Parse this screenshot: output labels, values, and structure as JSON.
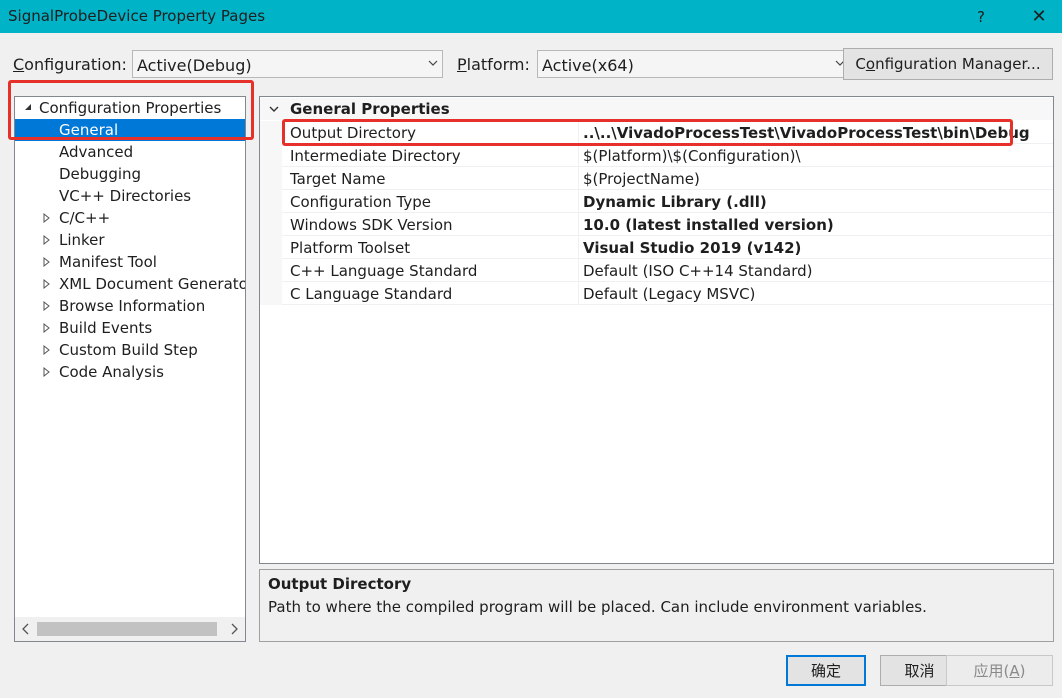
{
  "window": {
    "title": "SignalProbeDevice Property Pages",
    "help_label": "?",
    "close_label": "✕"
  },
  "toolbar": {
    "configuration_label_u": "C",
    "configuration_label_rest": "onfiguration:",
    "configuration_value": "Active(Debug)",
    "platform_label_u": "P",
    "platform_label_rest": "latform:",
    "platform_value": "Active(x64)",
    "config_manager_pre": "C",
    "config_manager_u": "o",
    "config_manager_rest": "nfiguration Manager..."
  },
  "tree": {
    "root": "Configuration Properties",
    "items": [
      {
        "label": "General",
        "expandable": false,
        "selected": true
      },
      {
        "label": "Advanced",
        "expandable": false,
        "selected": false
      },
      {
        "label": "Debugging",
        "expandable": false,
        "selected": false
      },
      {
        "label": "VC++ Directories",
        "expandable": false,
        "selected": false
      },
      {
        "label": "C/C++",
        "expandable": true,
        "selected": false
      },
      {
        "label": "Linker",
        "expandable": true,
        "selected": false
      },
      {
        "label": "Manifest Tool",
        "expandable": true,
        "selected": false
      },
      {
        "label": "XML Document Generato",
        "expandable": true,
        "selected": false
      },
      {
        "label": "Browse Information",
        "expandable": true,
        "selected": false
      },
      {
        "label": "Build Events",
        "expandable": true,
        "selected": false
      },
      {
        "label": "Custom Build Step",
        "expandable": true,
        "selected": false
      },
      {
        "label": "Code Analysis",
        "expandable": true,
        "selected": false
      }
    ]
  },
  "grid": {
    "category": "General Properties",
    "rows": [
      {
        "name": "Output Directory",
        "value": "..\\..\\VivadoProcessTest\\VivadoProcessTest\\bin\\Debug",
        "bold": true
      },
      {
        "name": "Intermediate Directory",
        "value": "$(Platform)\\$(Configuration)\\",
        "bold": false
      },
      {
        "name": "Target Name",
        "value": "$(ProjectName)",
        "bold": false
      },
      {
        "name": "Configuration Type",
        "value": "Dynamic Library (.dll)",
        "bold": true
      },
      {
        "name": "Windows SDK Version",
        "value": "10.0 (latest installed version)",
        "bold": true
      },
      {
        "name": "Platform Toolset",
        "value": "Visual Studio 2019 (v142)",
        "bold": true
      },
      {
        "name": "C++ Language Standard",
        "value": "Default (ISO C++14 Standard)",
        "bold": false
      },
      {
        "name": "C Language Standard",
        "value": "Default (Legacy MSVC)",
        "bold": false
      }
    ]
  },
  "description": {
    "title": "Output Directory",
    "text": "Path to where the compiled program will be placed. Can include environment variables."
  },
  "buttons": {
    "ok_label": "确定",
    "cancel_label": "取消",
    "apply_pre": "应用(",
    "apply_u": "A",
    "apply_post": ")"
  },
  "colors": {
    "titlebar": "#00b3c7",
    "selection": "#0078d7",
    "highlight_annotation": "#e6312b",
    "default_button_border": "#0078d7"
  }
}
